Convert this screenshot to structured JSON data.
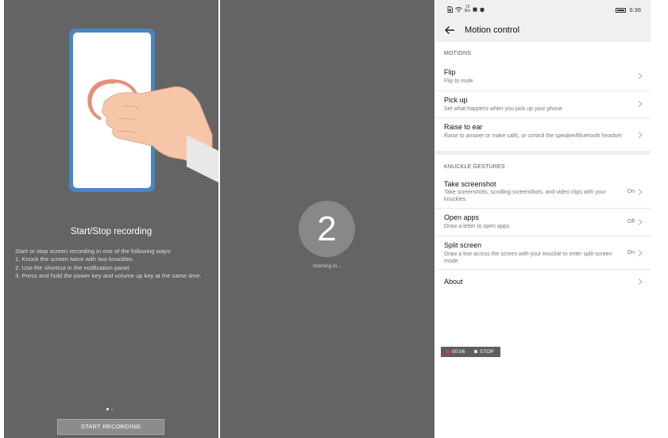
{
  "panel1": {
    "title": "Start/Stop recording",
    "description": [
      "Start or stop screen recording in one of the following ways:",
      "1. Knock the screen twice with two knuckles.",
      "2. Use the shortcut in the notification panel.",
      "3. Press and hold the power key and volume up key at the same time."
    ],
    "start_button": "START RECORDING",
    "page_indicator": {
      "current": 1,
      "total": 2
    }
  },
  "panel2": {
    "countdown": "2",
    "starting_text": "Starting in..."
  },
  "panel3": {
    "status_bar": {
      "time": "6:36",
      "net_speed_value": "72",
      "net_speed_unit": "B/s"
    },
    "title": "Motion control",
    "sections": [
      {
        "label": "MOTIONS",
        "items": [
          {
            "title": "Flip",
            "subtitle": "Flip to mute",
            "value": ""
          },
          {
            "title": "Pick up",
            "subtitle": "Set what happens when you pick up your phone",
            "value": ""
          },
          {
            "title": "Raise to ear",
            "subtitle": "Raise to answer or make calls, or control the speaker/Bluetooth headset",
            "value": ""
          }
        ]
      },
      {
        "label": "KNUCKLE GESTURES",
        "items": [
          {
            "title": "Take screenshot",
            "subtitle": "Take screenshots, scrolling screenshots, and video clips with your knuckles",
            "value": "On"
          },
          {
            "title": "Open apps",
            "subtitle": "Draw a letter to open apps",
            "value": "Off"
          },
          {
            "title": "Split screen",
            "subtitle": "Draw a line across the screen with your knuckle to enter split-screen mode",
            "value": "On"
          },
          {
            "title": "About",
            "subtitle": "",
            "value": ""
          }
        ]
      }
    ],
    "recording_bar": {
      "time": "00:06",
      "stop_label": "STOP"
    }
  }
}
